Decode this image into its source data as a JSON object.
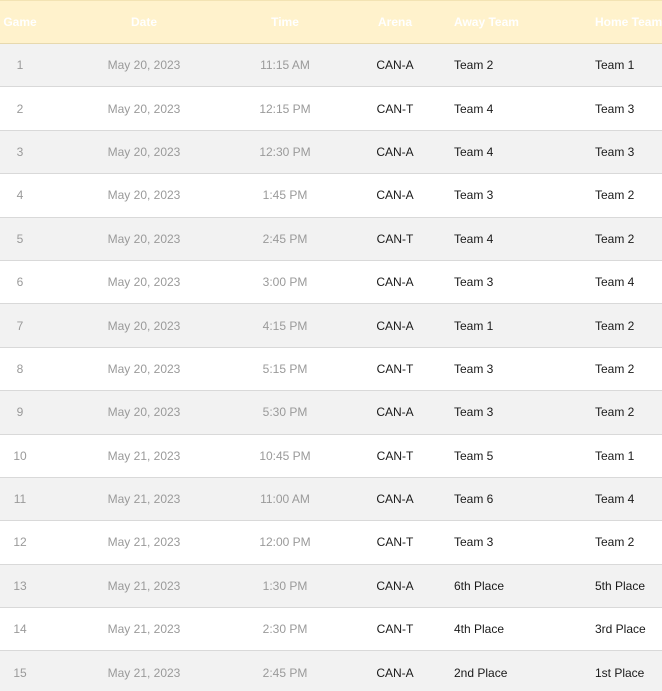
{
  "table": {
    "columns": {
      "game": "Game",
      "date": "Date",
      "time": "Time",
      "arena": "Arena",
      "away": "Away Team",
      "home": "Home Team"
    },
    "rows": [
      {
        "game": "1",
        "date": "May 20, 2023",
        "time": "11:15 AM",
        "arena": "CAN-A",
        "away": "Team 2",
        "home": "Team 1"
      },
      {
        "game": "2",
        "date": "May 20, 2023",
        "time": "12:15 PM",
        "arena": "CAN-T",
        "away": "Team 4",
        "home": "Team 3"
      },
      {
        "game": "3",
        "date": "May 20, 2023",
        "time": "12:30 PM",
        "arena": "CAN-A",
        "away": "Team 4",
        "home": "Team 3"
      },
      {
        "game": "4",
        "date": "May 20, 2023",
        "time": "1:45 PM",
        "arena": "CAN-A",
        "away": "Team 3",
        "home": "Team 2"
      },
      {
        "game": "5",
        "date": "May 20, 2023",
        "time": "2:45 PM",
        "arena": "CAN-T",
        "away": "Team 4",
        "home": "Team 2"
      },
      {
        "game": "6",
        "date": "May 20, 2023",
        "time": "3:00 PM",
        "arena": "CAN-A",
        "away": "Team 3",
        "home": "Team 4"
      },
      {
        "game": "7",
        "date": "May 20, 2023",
        "time": "4:15 PM",
        "arena": "CAN-A",
        "away": "Team 1",
        "home": "Team 2"
      },
      {
        "game": "8",
        "date": "May 20, 2023",
        "time": "5:15 PM",
        "arena": "CAN-T",
        "away": "Team 3",
        "home": "Team 2"
      },
      {
        "game": "9",
        "date": "May 20, 2023",
        "time": "5:30 PM",
        "arena": "CAN-A",
        "away": "Team 3",
        "home": "Team 2"
      },
      {
        "game": "10",
        "date": "May 21, 2023",
        "time": "10:45 PM",
        "arena": "CAN-T",
        "away": "Team 5",
        "home": "Team 1"
      },
      {
        "game": "11",
        "date": "May 21, 2023",
        "time": "11:00 AM",
        "arena": "CAN-A",
        "away": "Team 6",
        "home": "Team 4"
      },
      {
        "game": "12",
        "date": "May 21, 2023",
        "time": "12:00 PM",
        "arena": "CAN-T",
        "away": "Team 3",
        "home": "Team 2"
      },
      {
        "game": "13",
        "date": "May 21, 2023",
        "time": "1:30 PM",
        "arena": "CAN-A",
        "away": "6th Place",
        "home": "5th Place"
      },
      {
        "game": "14",
        "date": "May 21, 2023",
        "time": "2:30 PM",
        "arena": "CAN-T",
        "away": "4th Place",
        "home": "3rd Place"
      },
      {
        "game": "15",
        "date": "May 21, 2023",
        "time": "2:45 PM",
        "arena": "CAN-A",
        "away": "2nd Place",
        "home": "1st Place"
      }
    ]
  },
  "colors": {
    "header_background": "#fff2cc",
    "header_text": "#ffffff",
    "row_alt_background": "#f2f2f2",
    "row_background": "#ffffff",
    "muted_text": "#9a9a9a",
    "strong_text": "#1a1a1a"
  }
}
